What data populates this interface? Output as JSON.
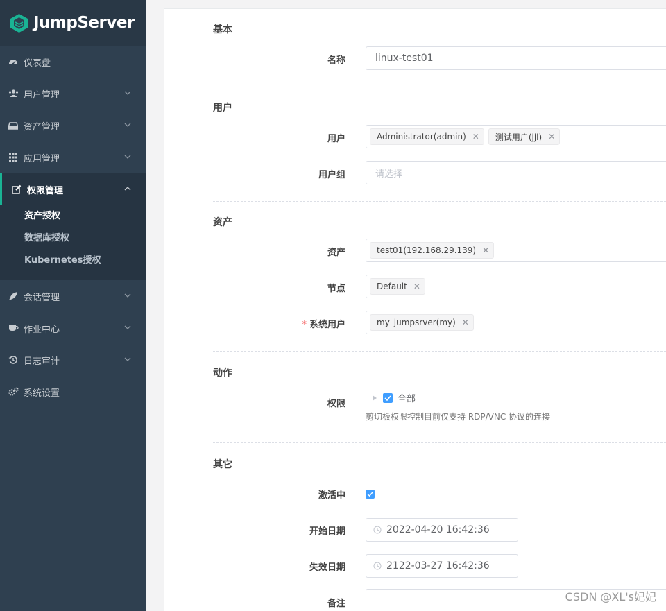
{
  "app": {
    "name": "JumpServer"
  },
  "sidebar": {
    "items": [
      {
        "label": "仪表盘",
        "icon": "dashboard-icon"
      },
      {
        "label": "用户管理",
        "icon": "users-icon"
      },
      {
        "label": "资产管理",
        "icon": "inbox-icon"
      },
      {
        "label": "应用管理",
        "icon": "grid-icon"
      },
      {
        "label": "权限管理",
        "icon": "edit-icon"
      },
      {
        "label": "会话管理",
        "icon": "rocket-icon"
      },
      {
        "label": "作业中心",
        "icon": "coffee-icon"
      },
      {
        "label": "日志审计",
        "icon": "history-icon"
      },
      {
        "label": "系统设置",
        "icon": "gears-icon"
      }
    ],
    "submenu": [
      "资产授权",
      "数据库授权",
      "Kubernetes授权"
    ]
  },
  "form": {
    "basic": {
      "title": "基本",
      "name_label": "名称",
      "name_value": "linux-test01"
    },
    "user": {
      "title": "用户",
      "users_label": "用户",
      "users": [
        "Administrator(admin)",
        "测试用户(jjl)"
      ],
      "groups_label": "用户组",
      "groups_placeholder": "请选择"
    },
    "asset": {
      "title": "资产",
      "assets_label": "资产",
      "assets": [
        "test01(192.168.29.139)"
      ],
      "nodes_label": "节点",
      "nodes": [
        "Default"
      ],
      "sysuser_label": "系统用户",
      "sysusers": [
        "my_jumpsrver(my)"
      ]
    },
    "action": {
      "title": "动作",
      "perm_label": "权限",
      "perm_all": "全部",
      "perm_hint": "剪切板权限控制目前仅支持 RDP/VNC 协议的连接"
    },
    "other": {
      "title": "其它",
      "active_label": "激活中",
      "start_label": "开始日期",
      "start_value": "2022-04-20 16:42:36",
      "expire_label": "失效日期",
      "expire_value": "2122-03-27 16:42:36",
      "comment_label": "备注"
    }
  },
  "watermark": "CSDN @XL's妃妃",
  "colors": {
    "sidebar": "#2f4050",
    "accent": "#1ab394",
    "checkbox": "#409eff"
  }
}
